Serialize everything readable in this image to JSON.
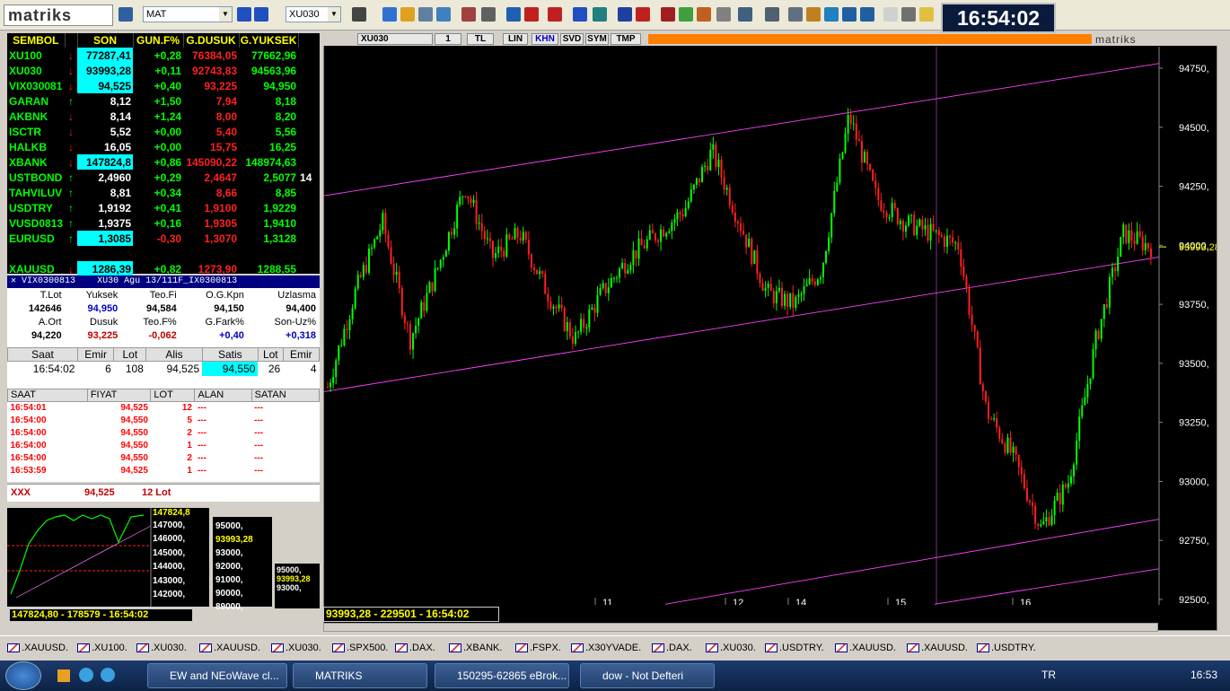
{
  "toolbar": {
    "logo": "matriks",
    "profile": "MAT",
    "symbol": "XU030"
  },
  "clock": "16:54:02",
  "watchlist": {
    "headers": [
      "SEMBOL",
      "SON",
      "GUN.F%",
      "G.DUSUK",
      "G.YUKSEK"
    ],
    "rows": [
      {
        "sym": "XU100",
        "dir": "down",
        "son": "77287,41",
        "hl": true,
        "gun": "+0,28",
        "dus": "76384,05",
        "yuk": "77662,96"
      },
      {
        "sym": "XU030",
        "dir": "down",
        "son": "93993,28",
        "hl": true,
        "gun": "+0,11",
        "dus": "92743,83",
        "yuk": "94563,96"
      },
      {
        "sym": "VIX030081",
        "dir": "down",
        "son": "94,525",
        "hl": true,
        "gun": "+0,40",
        "dus": "93,225",
        "yuk": "94,950"
      },
      {
        "sym": "GARAN",
        "dir": "up",
        "son": "8,12",
        "hl": false,
        "gun": "+1,50",
        "dus": "7,94",
        "yuk": "8,18"
      },
      {
        "sym": "AKBNK",
        "dir": "down",
        "son": "8,14",
        "hl": false,
        "gun": "+1,24",
        "dus": "8,00",
        "yuk": "8,20"
      },
      {
        "sym": "ISCTR",
        "dir": "down",
        "son": "5,52",
        "hl": false,
        "gun": "+0,00",
        "dus": "5,40",
        "yuk": "5,56"
      },
      {
        "sym": "HALKB",
        "dir": "down",
        "son": "16,05",
        "hl": false,
        "gun": "+0,00",
        "dus": "15,75",
        "yuk": "16,25"
      },
      {
        "sym": "XBANK",
        "dir": "down",
        "son": "147824,8",
        "hl": true,
        "gun": "+0,86",
        "dus": "145090,22",
        "yuk": "148974,63"
      },
      {
        "sym": "USTBOND",
        "dir": "up",
        "son": "2,4960",
        "hl": false,
        "gun": "+0,29",
        "dus": "2,4647",
        "yuk": "2,5077",
        "extra": "14"
      },
      {
        "sym": "TAHVILUV",
        "dir": "up",
        "son": "8,81",
        "hl": false,
        "gun": "+0,34",
        "dus": "8,66",
        "yuk": "8,85"
      },
      {
        "sym": "USDTRY",
        "dir": "up",
        "son": "1,9192",
        "hl": false,
        "gun": "+0,41",
        "dus": "1,9100",
        "yuk": "1,9229"
      },
      {
        "sym": "VUSD0813",
        "dir": "up",
        "son": "1,9375",
        "hl": false,
        "gun": "+0,16",
        "dus": "1,9305",
        "yuk": "1,9410"
      },
      {
        "sym": "EURUSD",
        "dir": "up",
        "son": "1,3085",
        "hl": true,
        "gun": "-0,30",
        "neg": true,
        "dus": "1,3070",
        "yuk": "1,3128"
      },
      {
        "sym": "",
        "dir": "",
        "son": "",
        "hl": false,
        "gun": "",
        "dus": "",
        "yuk": ""
      },
      {
        "sym": "XAUUSD",
        "dir": "down",
        "son": "1286,39",
        "hl": true,
        "gun": "+0,82",
        "dus": "1273,90",
        "yuk": "1288,55"
      }
    ]
  },
  "detail": {
    "title": "VIX0300813",
    "subtitle": "XU30 Agu 13/111F_IX0300813",
    "labels1": [
      "T.Lot",
      "Yuksek",
      "Teo.Fi",
      "O.G.Kpn",
      "Uzlasma"
    ],
    "values1": [
      "142646",
      "94,950",
      "94,584",
      "94,150",
      "94,400"
    ],
    "labels2": [
      "A.Ort",
      "Dusuk",
      "Teo.F%",
      "G.Fark%",
      "Son-Uz%"
    ],
    "values2": [
      "94,220",
      "93,225",
      "-0,062",
      "+0,40",
      "+0,318"
    ],
    "orderhdr": [
      "Saat",
      "Emir",
      "Lot",
      "Alis",
      "Satis",
      "Lot",
      "Emir"
    ],
    "orderrow": [
      "16:54:02",
      "6",
      "108",
      "94,525",
      "94,550",
      "26",
      "4"
    ],
    "orderextra": "1",
    "tradehdr": [
      "SAAT",
      "FIYAT",
      "LOT",
      "ALAN",
      "SATAN"
    ],
    "trades": [
      [
        "16:54:01",
        "94,525",
        "12",
        "---",
        "---"
      ],
      [
        "16:54:00",
        "94,550",
        "5",
        "---",
        "---"
      ],
      [
        "16:54:00",
        "94,550",
        "2",
        "---",
        "---"
      ],
      [
        "16:54:00",
        "94,550",
        "1",
        "---",
        "---"
      ],
      [
        "16:54:00",
        "94,550",
        "2",
        "---",
        "---"
      ],
      [
        "16:53:59",
        "94,525",
        "1",
        "---",
        "---"
      ]
    ],
    "xxx": [
      "XXX",
      "94,525",
      "12 Lot"
    ]
  },
  "mini1": {
    "last": "147824,8",
    "ticks": [
      "147000,",
      "146000,",
      "145000,",
      "144000,",
      "143000,",
      "142000,"
    ],
    "status": "147824,80 - 178579 - 16:54:02"
  },
  "mini2": {
    "ticks": [
      "95000,",
      "93993,28",
      "93000,",
      "92000,",
      "91000,",
      "90000,",
      "89000,"
    ]
  },
  "mini3": {
    "ticks": [
      "95000,",
      "93993,28",
      "93000,"
    ]
  },
  "chart": {
    "toolbar": {
      "symbol": "XU030",
      "period": "1",
      "currency": "TL",
      "scale": "LIN",
      "btns": [
        "KHN",
        "SVD",
        "SYM",
        "TMP"
      ],
      "brand": "matriks"
    },
    "status": "93993,28 - 229501 - 16:54:02",
    "last": "93993,28",
    "yticks": [
      "94750,",
      "94500,",
      "94250,",
      "94000,",
      "93750,",
      "93500,",
      "93250,",
      "93000,",
      "92750,",
      "92500,"
    ],
    "xticks": [
      "11",
      "12",
      "14",
      "15",
      "16"
    ]
  },
  "chart_data": {
    "type": "candlestick",
    "ylim": [
      92500,
      94750
    ],
    "last": 93993.28,
    "x": [
      "11",
      "12",
      "14",
      "15",
      "16"
    ],
    "close_path": [
      93400,
      93800,
      94100,
      93600,
      93900,
      94250,
      93950,
      94050,
      93800,
      93600,
      93800,
      93950,
      94050,
      94150,
      94400,
      94100,
      93800,
      93750,
      93900,
      94550,
      94200,
      94100,
      94050,
      94000,
      93300,
      93100,
      92800,
      93000,
      93600,
      94050,
      93993.28
    ]
  },
  "tabs": [
    ".XAUUSD.",
    ".XU100.",
    ".XU030.",
    ".XAUUSD.",
    ".XU030.",
    ".SPX500.",
    ".DAX.",
    ".XBANK.",
    ".FSPX.",
    ".X30YVADE.",
    ".DAX.",
    ".XU030.",
    ".USDTRY.",
    ".XAUUSD.",
    ".XAUUSD.",
    ".USDTRY."
  ],
  "taskbar": {
    "items": [
      "EW and NEoWave cl...",
      "MATRIKS",
      "150295-62865 eBrok...",
      "dow - Not Defteri"
    ],
    "lang": "TR",
    "time": "16:53"
  }
}
